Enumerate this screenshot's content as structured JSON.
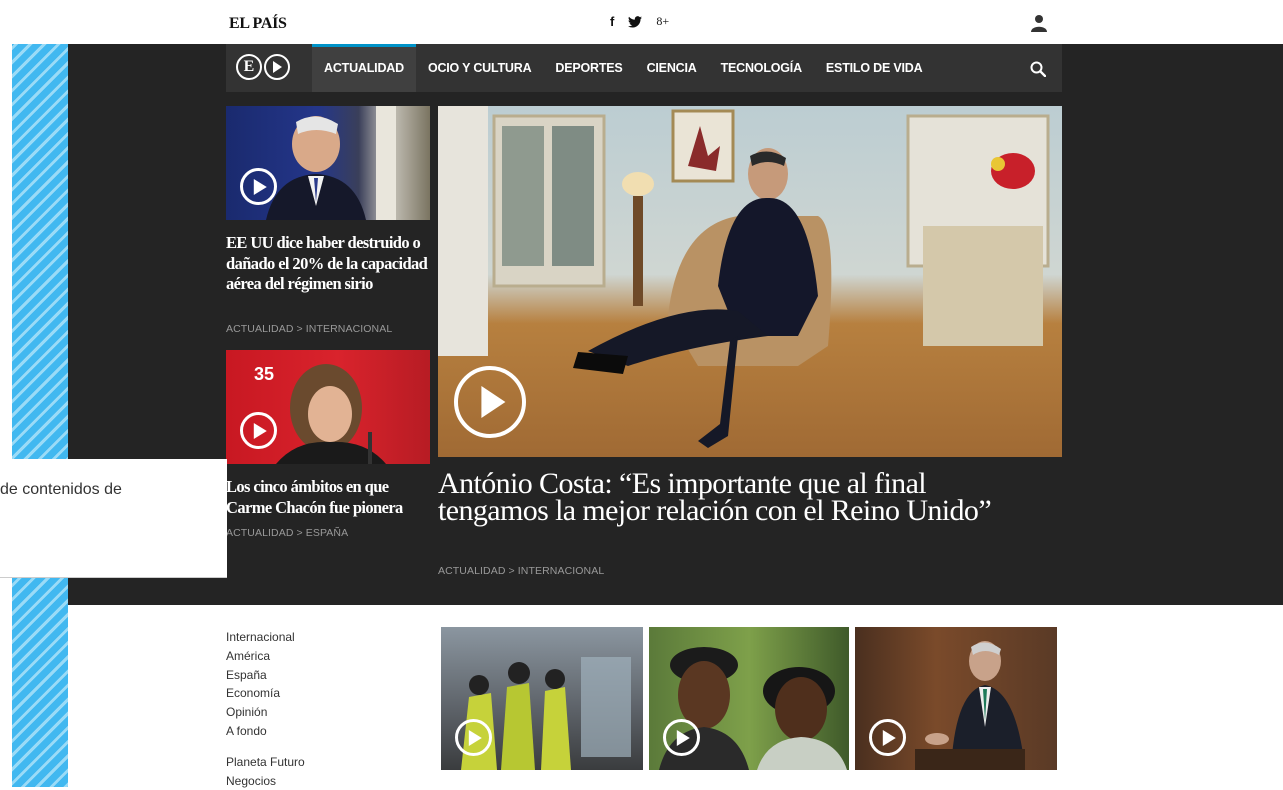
{
  "header": {
    "logo": "EL PAÍS",
    "social": [
      "f",
      "8+"
    ],
    "social_icons": [
      "facebook-icon",
      "twitter-icon",
      "google-plus-icon"
    ]
  },
  "nav": {
    "logo_letter": "E",
    "items": [
      {
        "label": "ACTUALIDAD",
        "active": true
      },
      {
        "label": "OCIO Y CULTURA"
      },
      {
        "label": "DEPORTES"
      },
      {
        "label": "CIENCIA"
      },
      {
        "label": "TECNOLOGÍA"
      },
      {
        "label": "ESTILO DE VIDA"
      }
    ]
  },
  "stories": {
    "top_left": {
      "title": "EE UU dice haber destruido o dañado el 20% de la capacidad aérea del régimen sirio",
      "kicker": "ACTUALIDAD > INTERNACIONAL"
    },
    "mid_left": {
      "title": "Los cinco ámbitos en que Carme Chacón fue pionera",
      "kicker": "ACTUALIDAD > ESPAÑA"
    },
    "main": {
      "title": "António Costa: “Es importante que al final tengamos la mejor relación con el Reino Unido”",
      "kicker": "ACTUALIDAD > INTERNACIONAL"
    }
  },
  "overlay": {
    "text": "de contenidos de"
  },
  "sections": {
    "group1": [
      "Internacional",
      "América",
      "España",
      "Economía",
      "Opinión",
      "A fondo"
    ],
    "group2": [
      "Planeta Futuro",
      "Negocios"
    ]
  },
  "colors": {
    "accent": "#0093c8",
    "dark_bg": "#242424",
    "nav_bg": "#333333",
    "stripe": "#41b8f0"
  }
}
